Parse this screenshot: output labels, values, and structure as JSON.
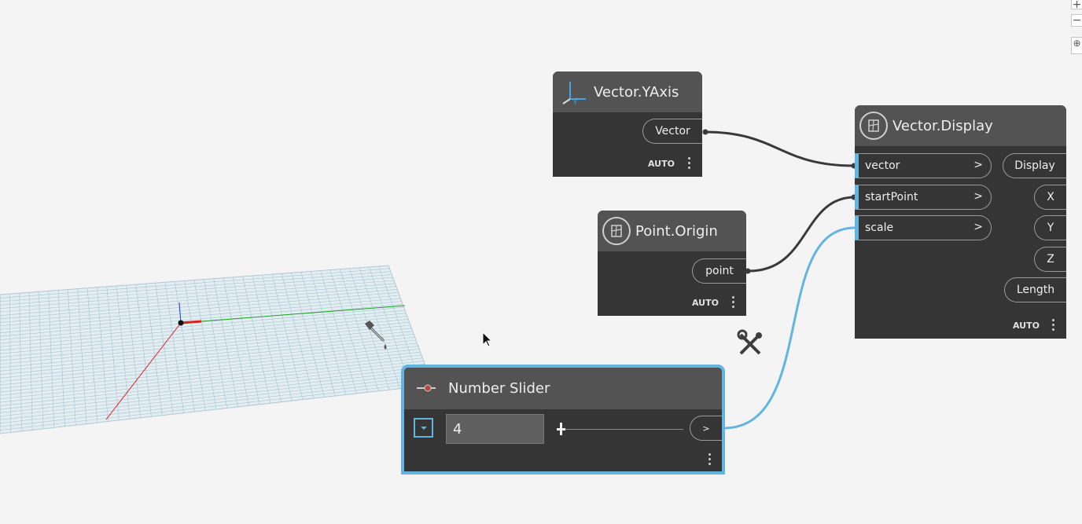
{
  "nodes": {
    "yaxis": {
      "title": "Vector.YAxis",
      "output": "Vector",
      "lacing": "AUTO",
      "icon": "yaxis-icon"
    },
    "origin": {
      "title": "Point.Origin",
      "output": "point",
      "lacing": "AUTO",
      "icon": "geometry-icon"
    },
    "display": {
      "title": "Vector.Display",
      "inputs": [
        "vector",
        "startPoint",
        "scale"
      ],
      "input_arrow": ">",
      "outputs": [
        "Display",
        "X",
        "Y",
        "Z",
        "Length"
      ],
      "lacing": "AUTO",
      "icon": "geometry-icon"
    },
    "slider": {
      "title": "Number Slider",
      "value": "4",
      "output_arrow": ">",
      "icon": "slider-icon"
    }
  },
  "colors": {
    "canvas": "#f4f4f4",
    "node_body": "#353535",
    "node_header": "#535353",
    "selection": "#62b5e0",
    "wire": "#3a3a3a"
  },
  "viewport": {
    "axis_x_color": "#e02020",
    "axis_y_color": "#20a020",
    "axis_z_color": "#2040e0"
  }
}
